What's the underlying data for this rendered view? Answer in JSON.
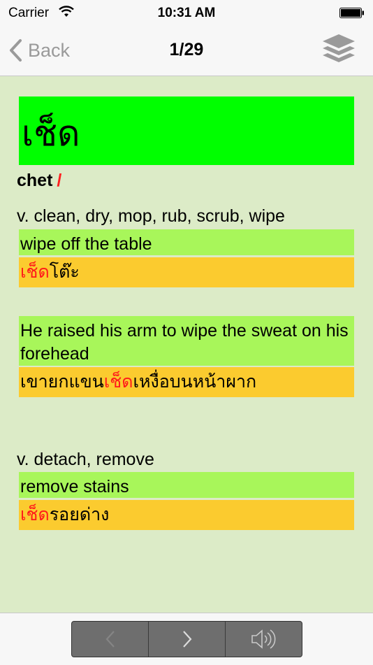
{
  "status_bar": {
    "carrier": "Carrier",
    "time": "10:31 AM"
  },
  "nav": {
    "back_label": "Back",
    "title": "1/29",
    "layers_icon": "layers-icon"
  },
  "entry": {
    "headword": "เช็ด",
    "romanization": "chet",
    "tone_mark": "/",
    "senses": [
      {
        "pos": "v. clean, dry, mop, rub, scrub, wipe",
        "examples": [
          {
            "english": "wipe off the table",
            "thai_highlight": "เช็ด",
            "thai_rest": "โต๊ะ"
          },
          {
            "english": "He raised his arm to wipe the sweat on his forehead",
            "thai_prefix": "เขายกแขน",
            "thai_highlight": "เช็ด",
            "thai_rest": "เหงื่อบนหน้าผาก"
          }
        ]
      },
      {
        "pos": "v. detach, remove",
        "examples": [
          {
            "english": "remove stains",
            "thai_highlight": "เช็ด",
            "thai_rest": "รอยด่าง"
          }
        ]
      }
    ]
  },
  "toolbar": {
    "prev_icon": "chevron-left-icon",
    "next_icon": "chevron-right-icon",
    "sound_icon": "speaker-icon"
  },
  "colors": {
    "headword_bg": "#00ff00",
    "english_bg": "#a8f65a",
    "thai_bg": "#fbcb2f",
    "highlight": "#ff1a1a",
    "content_bg": "#dcebc7"
  }
}
